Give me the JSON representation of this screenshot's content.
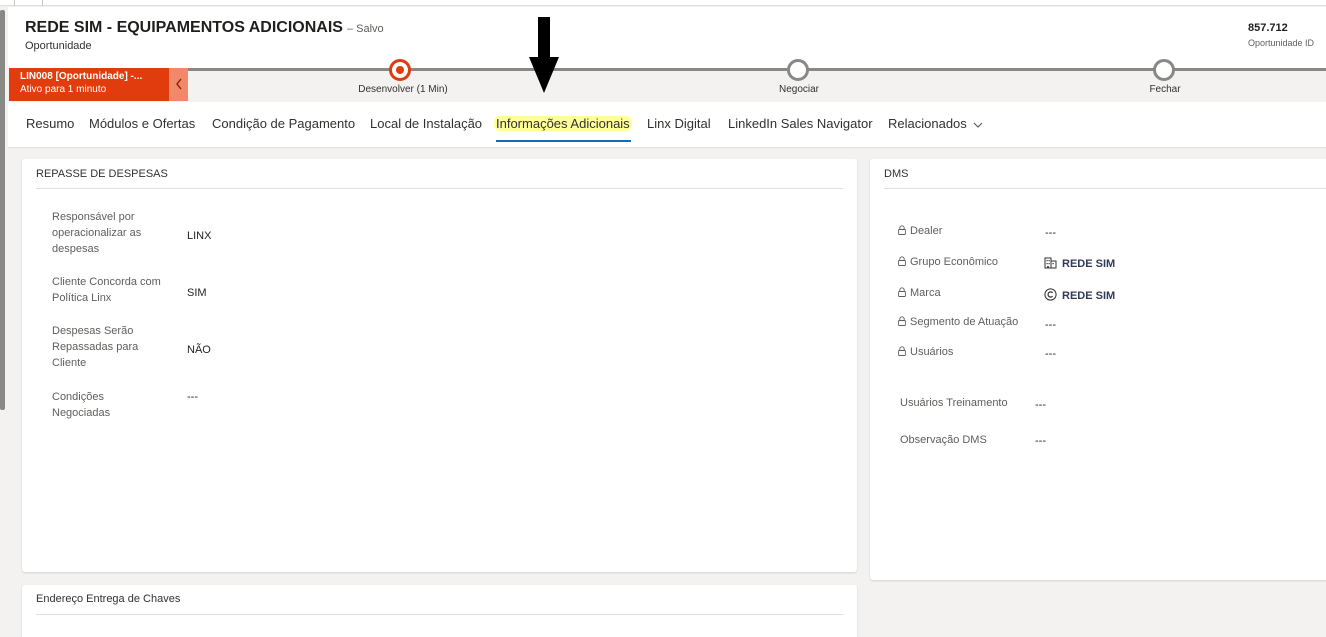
{
  "header": {
    "title": "REDE SIM - EQUIPAMENTOS ADICIONAIS",
    "saved": "– Salvo",
    "entity": "Oportunidade",
    "id_value": "857.712",
    "id_label": "Oportunidade ID"
  },
  "bpf": {
    "active_title": "LIN008 [Oportunidade] -...",
    "active_sub": "Ativo para 1 minuto",
    "collapse_icon": "chevron-left-icon",
    "stages": [
      {
        "label": "Desenvolver  (1 Min)",
        "state": "active"
      },
      {
        "label": "Negociar",
        "state": "inactive"
      },
      {
        "label": "Fechar",
        "state": "inactive"
      }
    ]
  },
  "tabs": [
    {
      "label": "Resumo"
    },
    {
      "label": "Módulos e Ofertas"
    },
    {
      "label": "Condição de Pagamento"
    },
    {
      "label": "Local de Instalação"
    },
    {
      "label": "Informações Adicionais"
    },
    {
      "label": "Linx Digital"
    },
    {
      "label": "LinkedIn Sales Navigator"
    },
    {
      "label": "Relacionados"
    }
  ],
  "repasse": {
    "title": "REPASSE DE DESPESAS",
    "fields": [
      {
        "label_lines": [
          "Responsável por",
          "operacionalizar as",
          "despesas"
        ],
        "value": "LINX"
      },
      {
        "label_lines": [
          "Cliente Concorda com",
          "Política Linx"
        ],
        "value": "SIM"
      },
      {
        "label_lines": [
          "Despesas Serão",
          "Repassadas para",
          "Cliente"
        ],
        "value": "NÃO"
      },
      {
        "label_lines": [
          "Condições",
          "Negociadas"
        ],
        "value": "---"
      }
    ]
  },
  "dms": {
    "title": "DMS",
    "locked_fields": [
      {
        "label": "Dealer",
        "value": "---"
      },
      {
        "label": "Grupo Econômico",
        "value": "REDE SIM",
        "icon": "building-icon"
      },
      {
        "label": "Marca",
        "value": "REDE SIM",
        "icon": "copyright-icon"
      },
      {
        "label": "Segmento de Atuação",
        "value": "---"
      },
      {
        "label": "Usuários",
        "value": "---"
      }
    ],
    "fields": [
      {
        "label": "Usuários Treinamento",
        "value": "---"
      },
      {
        "label": "Observação DMS",
        "value": "---"
      }
    ]
  },
  "endereco": {
    "title": "Endereço Entrega de Chaves"
  }
}
